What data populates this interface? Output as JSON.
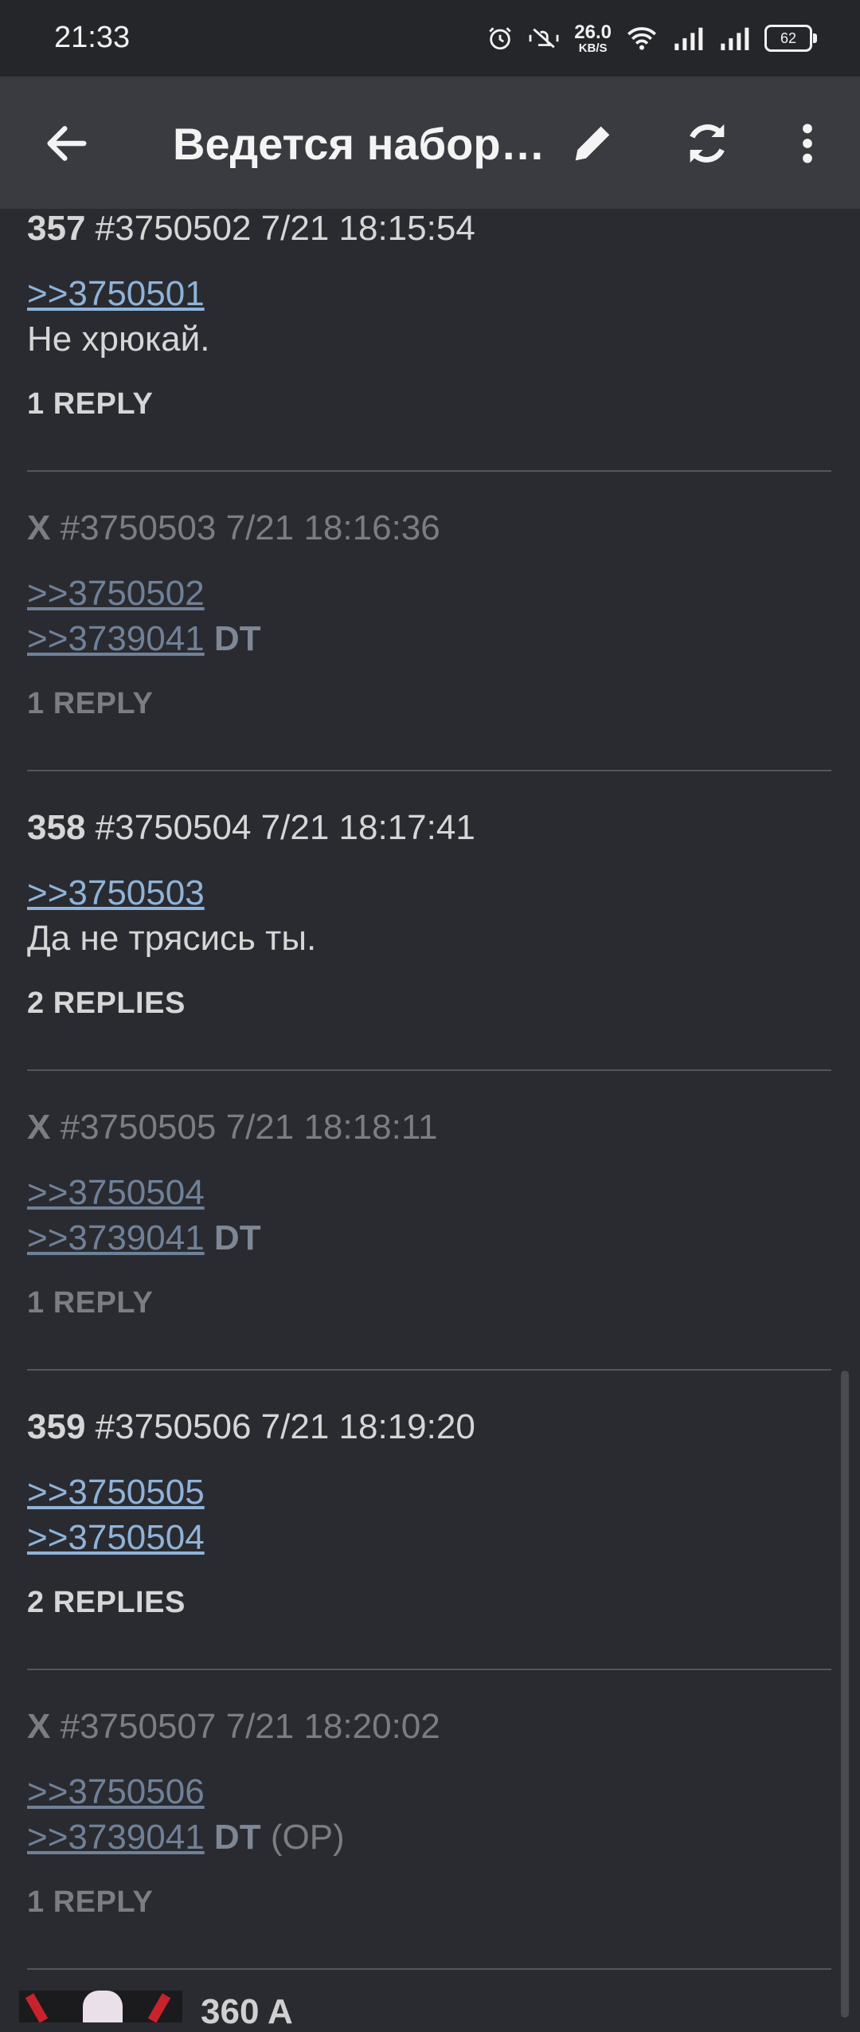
{
  "status": {
    "time": "21:33",
    "net_value": "26.0",
    "net_unit": "KB/S",
    "battery": "62"
  },
  "appbar": {
    "title": "Ведется набор…",
    "icons": [
      "back-arrow-icon",
      "pencil-icon",
      "refresh-icon",
      "more-vert-icon"
    ]
  },
  "posts": [
    {
      "num": "357",
      "id": "#3750502",
      "date": "7/21 18:15:54",
      "links": [
        ">>3750501"
      ],
      "text": "Не хрюкай.",
      "replies": "1 REPLY",
      "hidden": false
    },
    {
      "num": "X",
      "id": "#3750503",
      "date": "7/21 18:16:36",
      "links": [
        ">>3750502",
        ">>3739041"
      ],
      "tag": "DT",
      "replies": "1 REPLY",
      "hidden": true
    },
    {
      "num": "358",
      "id": "#3750504",
      "date": "7/21 18:17:41",
      "links": [
        ">>3750503"
      ],
      "text": "Да не трясись ты.",
      "replies": "2 REPLIES",
      "hidden": false
    },
    {
      "num": "X",
      "id": "#3750505",
      "date": "7/21 18:18:11",
      "links": [
        ">>3750504",
        ">>3739041"
      ],
      "tag": "DT",
      "replies": "1 REPLY",
      "hidden": true
    },
    {
      "num": "359",
      "id": "#3750506",
      "date": "7/21 18:19:20",
      "links": [
        ">>3750505",
        ">>3750504"
      ],
      "replies": "2 REPLIES",
      "hidden": false
    },
    {
      "num": "X",
      "id": "#3750507",
      "date": "7/21 18:20:02",
      "links": [
        ">>3750506",
        ">>3739041"
      ],
      "tag": "DT",
      "tag_suffix": "(OP)",
      "replies": "1 REPLY",
      "hidden": true
    }
  ],
  "next_post": {
    "label": "360 A"
  },
  "colors": {
    "background": "#2a2b30",
    "appbar": "#3a3b40",
    "link": "#8fb3d9"
  }
}
